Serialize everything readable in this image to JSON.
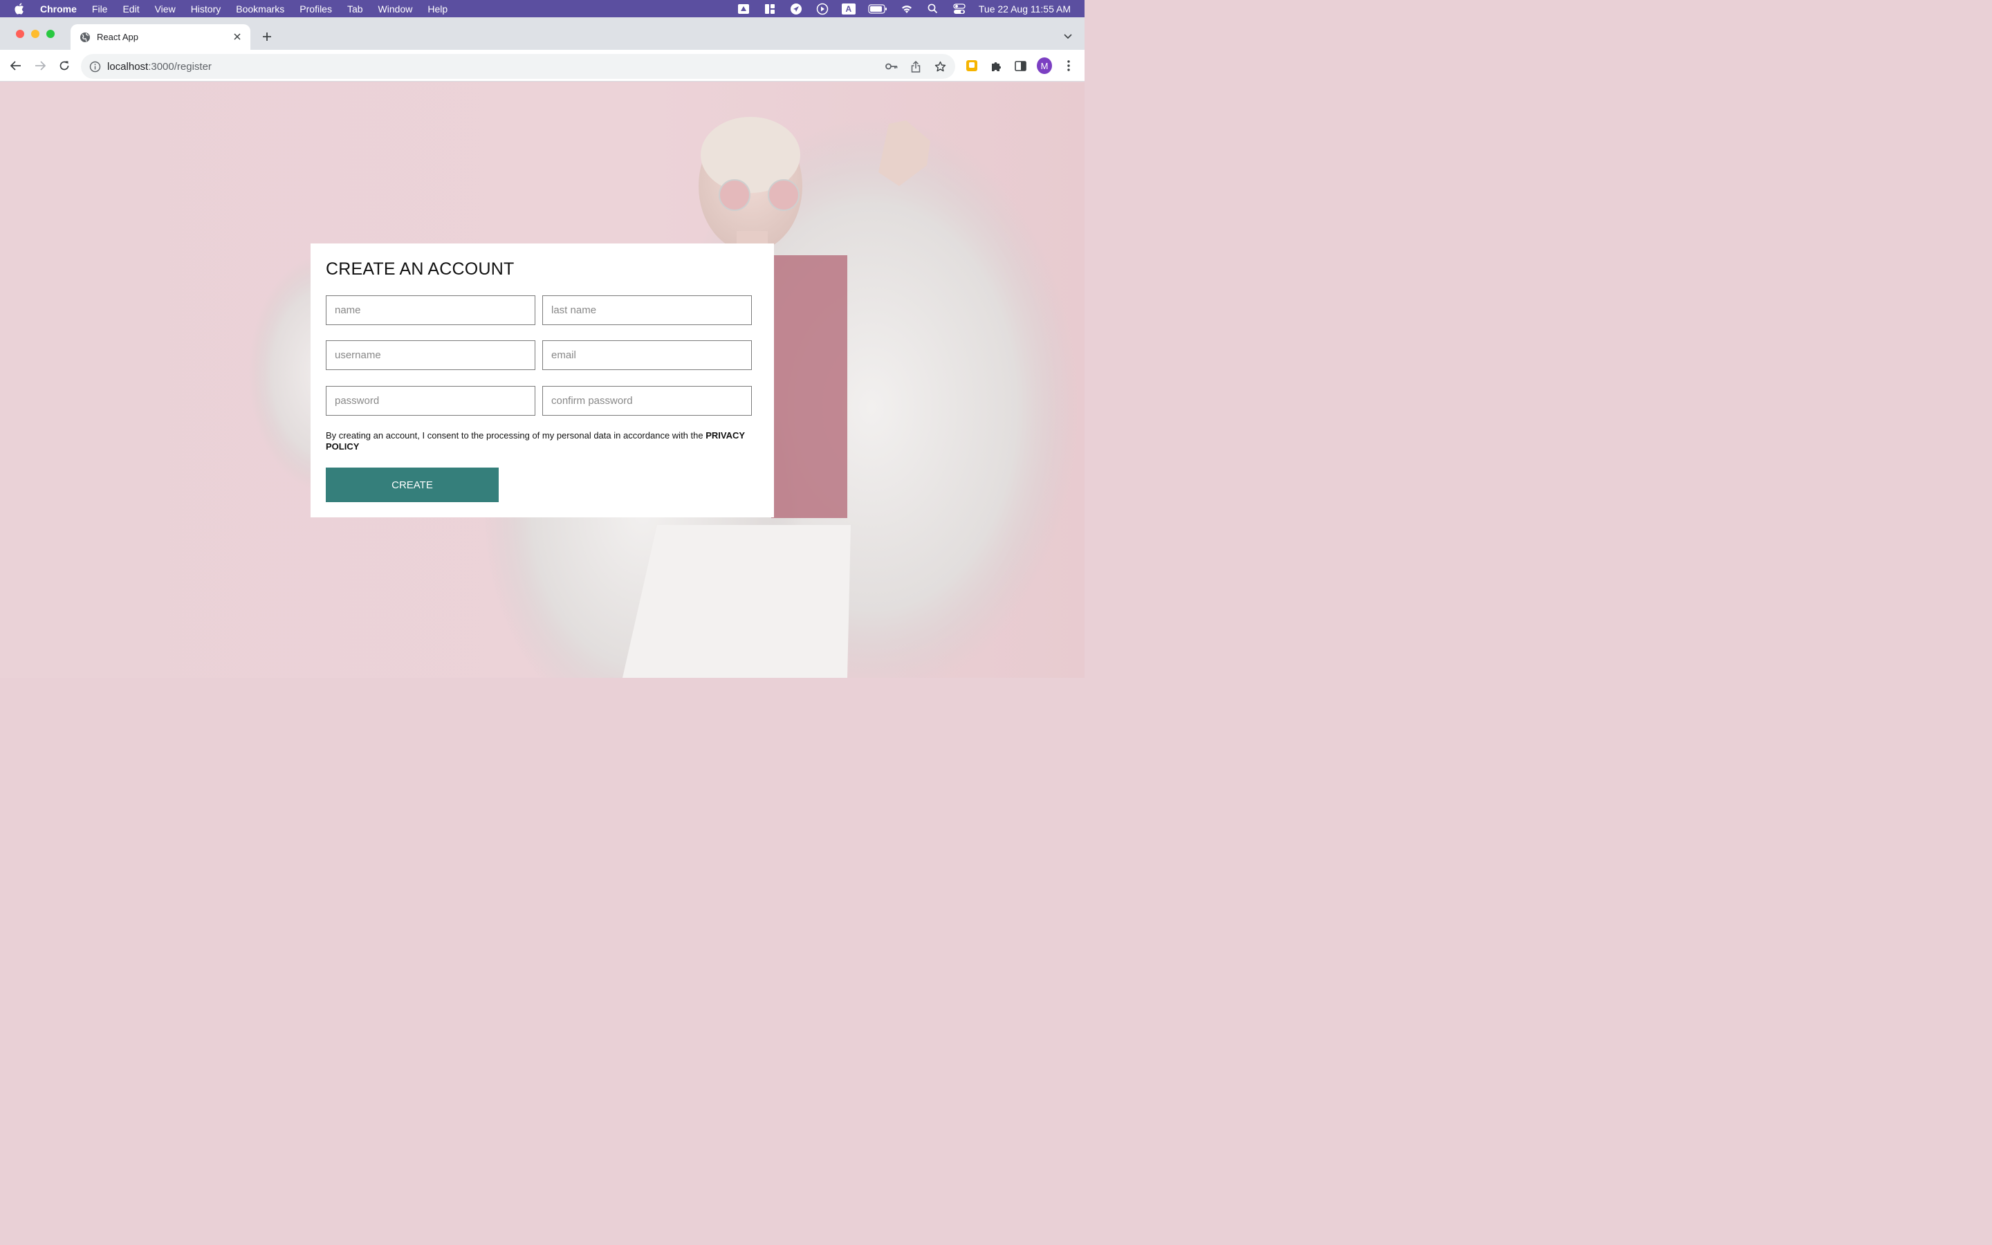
{
  "menubar": {
    "app_name": "Chrome",
    "items": [
      "File",
      "Edit",
      "View",
      "History",
      "Bookmarks",
      "Profiles",
      "Tab",
      "Window",
      "Help"
    ],
    "clock": "Tue 22 Aug  11:55 AM",
    "input_indicator": "A"
  },
  "browser": {
    "tab_title": "React App",
    "url_host": "localhost",
    "url_path": ":3000/register",
    "avatar_letter": "M"
  },
  "form": {
    "title": "CREATE AN ACCOUNT",
    "fields": {
      "name": "name",
      "last_name": "last name",
      "username": "username",
      "email": "email",
      "password": "password",
      "confirm_password": "confirm password"
    },
    "consent_text": "By creating an account, I consent to the processing of my personal data in accordance with the ",
    "consent_link": "PRIVACY POLICY",
    "submit_label": "CREATE"
  },
  "colors": {
    "menubar": "#5b4fa0",
    "background": "#ead2d7",
    "button": "#357f7b"
  }
}
